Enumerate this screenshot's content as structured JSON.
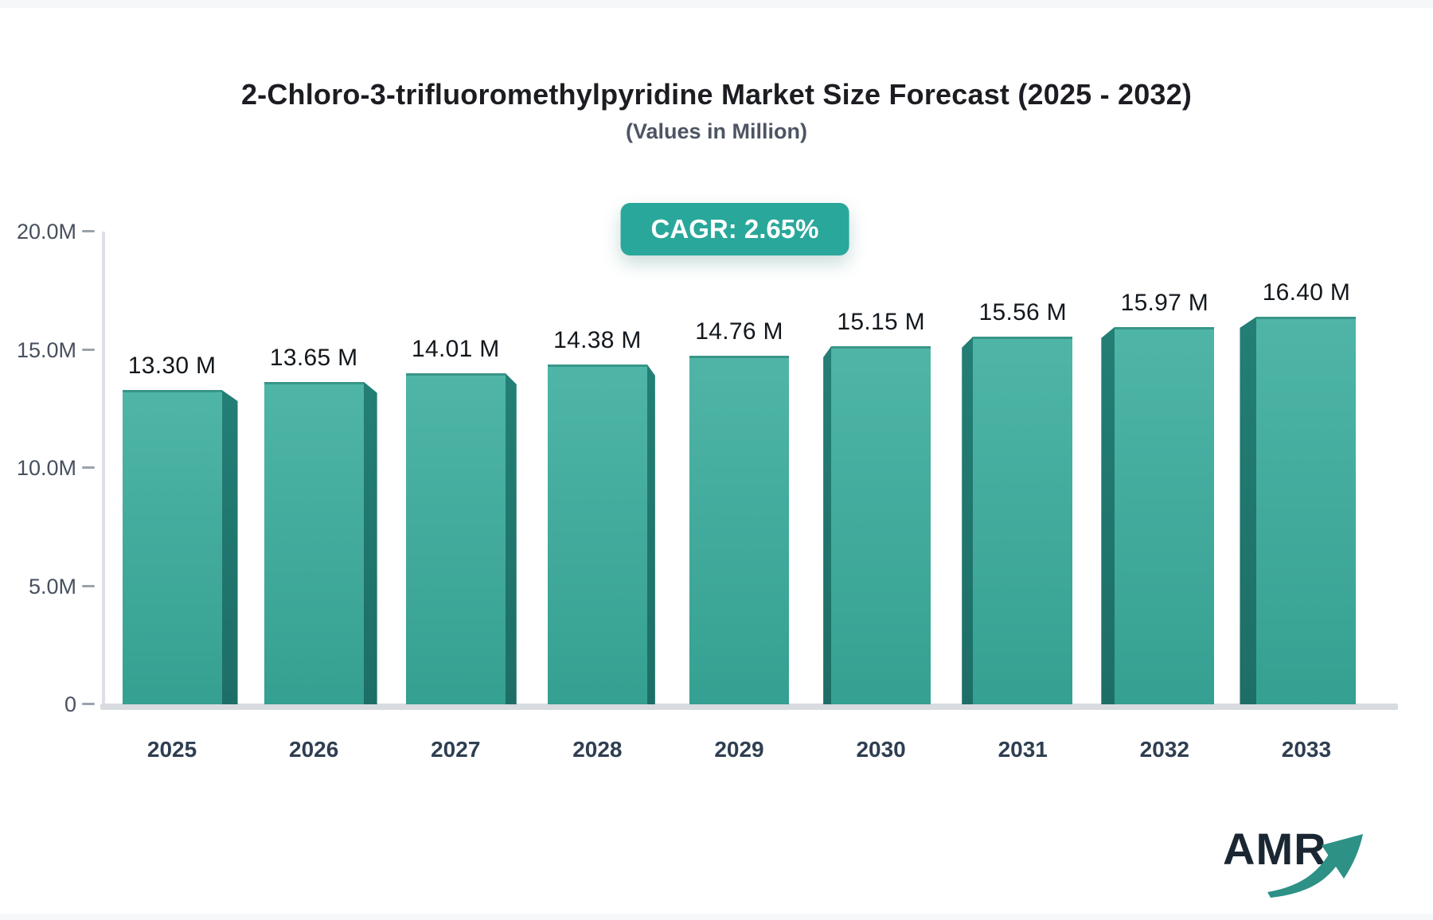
{
  "chart_data": {
    "type": "bar",
    "title": "2-Chloro-3-trifluoromethylpyridine Market Size Forecast (2025 - 2032)",
    "subtitle": "(Values in Million)",
    "badge_label": "CAGR: 2.65%",
    "categories": [
      "2025",
      "2026",
      "2027",
      "2028",
      "2029",
      "2030",
      "2031",
      "2032",
      "2033"
    ],
    "values": [
      13.3,
      13.65,
      14.01,
      14.38,
      14.76,
      15.15,
      15.56,
      15.97,
      16.4
    ],
    "bar_labels": [
      "13.30 M",
      "13.65 M",
      "14.01 M",
      "14.38 M",
      "14.76 M",
      "15.15 M",
      "15.56 M",
      "15.97 M",
      "16.40 M"
    ],
    "unit": "Million",
    "xlabel": "",
    "ylabel": "",
    "ylim": [
      0,
      20
    ],
    "yticks": {
      "labels": [
        "0",
        "5.0M",
        "10.0M",
        "15.0M",
        "20.0M"
      ],
      "values": [
        0,
        5,
        10,
        15,
        20
      ]
    },
    "grid": false,
    "legend": null,
    "colors": {
      "bar_face_top": "#4fb5a7",
      "bar_face_bottom": "#35a091",
      "bar_side_top": "#237f76",
      "bar_side_bottom": "#1d6e66",
      "bar_top_edge": "rgba(0,70,62,0.28)",
      "badge_bg": "#2aa79b",
      "badge_text": "#ffffff",
      "axis": "#dcdfe3",
      "tick_label": "#47505e",
      "year_label": "#2f3e51",
      "value_label": "#13181d"
    }
  },
  "logo": {
    "text": "AMR",
    "arrow_icon": "trend-up-arrow",
    "arrow_color": "#2d9186",
    "text_color": "#1a2732"
  }
}
